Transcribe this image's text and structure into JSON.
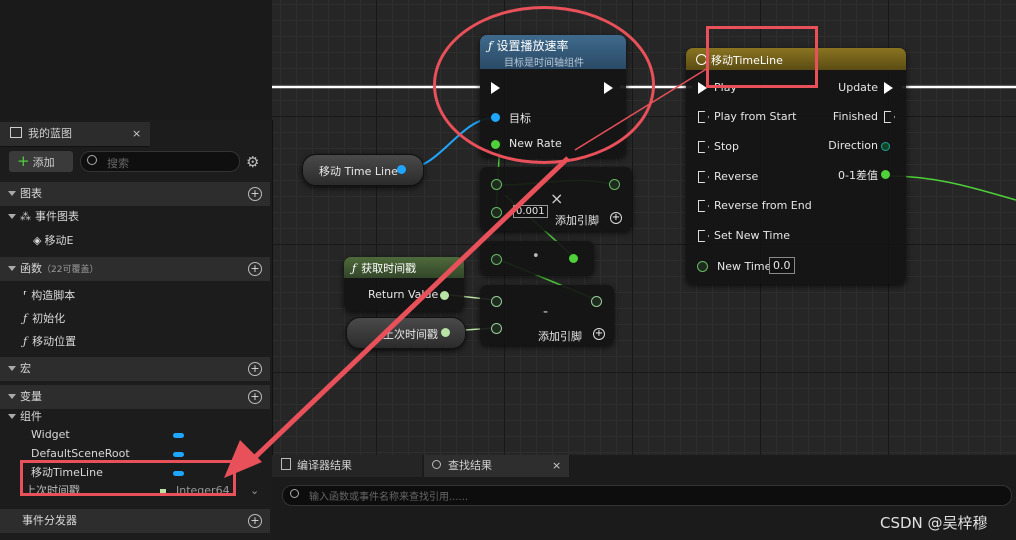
{
  "panel": {
    "tab_title": "我的蓝图",
    "tab_close": "×",
    "add_label": "添加",
    "search_placeholder": "搜索",
    "sections": {
      "graphs": "图表",
      "functions": "函数",
      "functions_note": "（22可覆盖）",
      "macros": "宏",
      "variables": "变量",
      "dispatchers": "事件分发器"
    },
    "graph_items": [
      "事件图表",
      "移动E"
    ],
    "function_items": [
      "构造脚本",
      "初始化",
      "移动位置"
    ],
    "components_label": "组件",
    "variables": [
      {
        "name": "Widget"
      },
      {
        "name": "DefaultSceneRoot"
      },
      {
        "name": "移动TimeLine"
      },
      {
        "name": "上次时间戳",
        "type": "Integer64"
      }
    ]
  },
  "graph": {
    "set_rate": {
      "title": "设置播放速率",
      "subtitle": "目标是时间轴组件",
      "pin_target": "目标",
      "pin_rate": "New Rate"
    },
    "var_node": "移动 Time Line",
    "timeline": {
      "title": "移动TimeLine",
      "inputs": [
        "Play",
        "Play from Start",
        "Stop",
        "Reverse",
        "Reverse from End",
        "Set New Time"
      ],
      "outputs": [
        "Update",
        "Finished",
        "Direction",
        "0-1差值"
      ],
      "new_time_label": "New Time",
      "new_time_value": "0.0"
    },
    "divide": {
      "symbol": "×",
      "value": "0.001",
      "add_pin": "添加引脚"
    },
    "convert": {
      "symbol": "•"
    },
    "get_time": {
      "title": "获取时间戳",
      "return_label": "Return Value"
    },
    "last_time_var": "上次时间戳",
    "subtract": {
      "symbol": "-",
      "add_pin": "添加引脚"
    }
  },
  "bottom": {
    "tab_compiler": "编译器结果",
    "tab_find": "查找结果",
    "find_close": "×",
    "find_placeholder": "输入函数或事件名称来查找引用......"
  },
  "watermark": "CSDN @吴梓穆",
  "colors": {
    "object_pin": "#1fa7ff",
    "float_pin": "#4fd13a",
    "annotation": "#e8505a",
    "timeline_header": "#8a7420"
  }
}
